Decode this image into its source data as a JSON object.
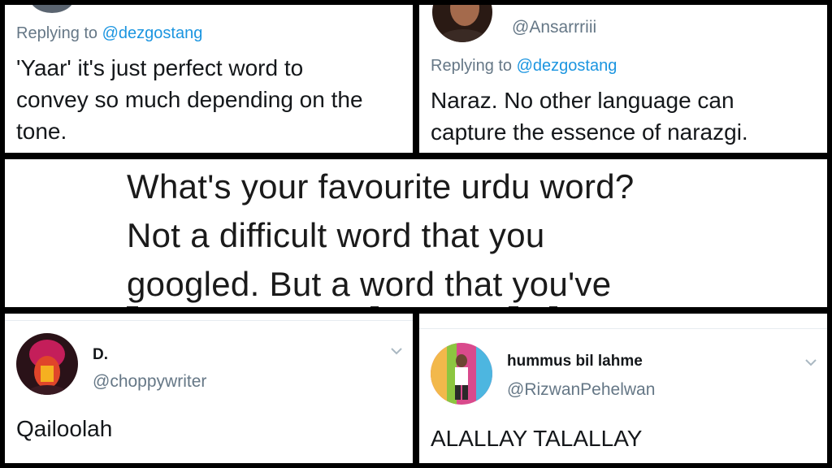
{
  "tweet_top_left": {
    "reply_prefix": "Replying to",
    "reply_handle": "@dezgostang",
    "body_lines": [
      "'Yaar' it's just perfect word to",
      "convey so much depending on the",
      "tone."
    ]
  },
  "tweet_top_right": {
    "handle": "@Ansarrriii",
    "reply_prefix": "Replying to",
    "reply_handle": "@dezgostang",
    "body_lines": [
      "Naraz. No other language can",
      "capture the essence of narazgi."
    ]
  },
  "center_question": {
    "lines": [
      "What's your favourite urdu word?",
      "Not a difficult word that you",
      "googled. But a word that you've"
    ]
  },
  "tweet_bottom_left": {
    "name": "D.",
    "handle": "@choppywriter",
    "body": "Qailoolah"
  },
  "tweet_bottom_right": {
    "name": "hummus bil lahme",
    "handle": "@RizwanPehelwan",
    "body": "ALALLAY TALALLAY"
  },
  "colors": {
    "frame": "#000000",
    "link_blue": "#1b95e0",
    "muted_gray": "#657786",
    "text_dark": "#14171a"
  },
  "icons": [
    "chevron-down-icon"
  ]
}
